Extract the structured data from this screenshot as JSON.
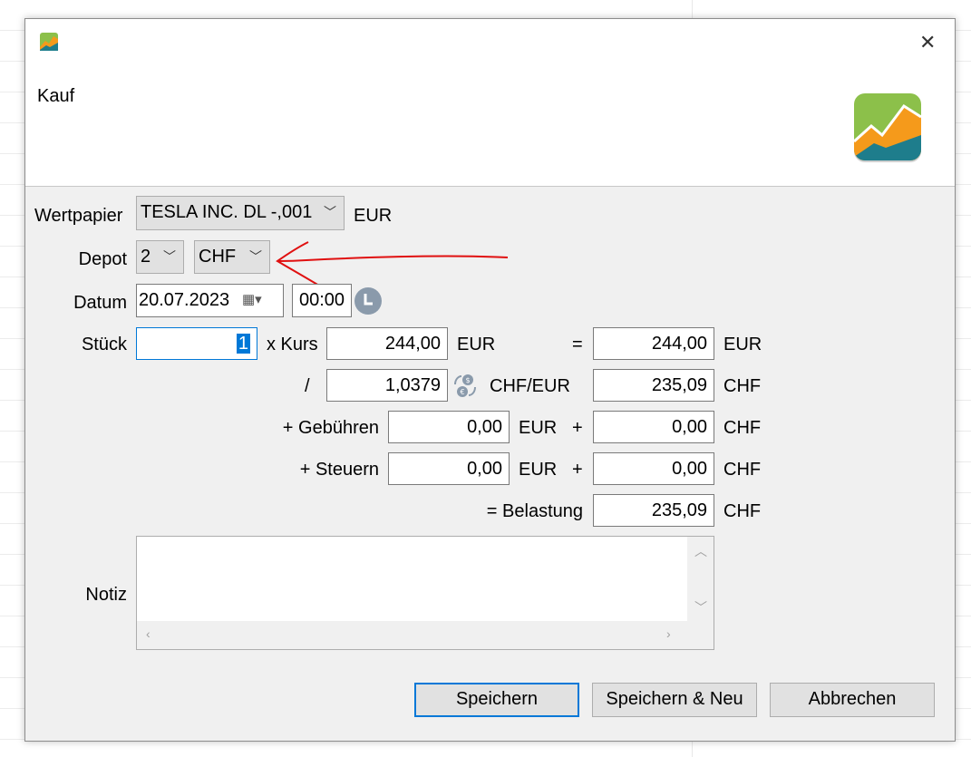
{
  "window": {
    "title": "Kauf",
    "close_glyph": "✕"
  },
  "form": {
    "wertpapier_label": "Wertpapier",
    "wertpapier_value": "TESLA INC. DL -,001",
    "wertpapier_currency": "EUR",
    "depot_label": "Depot",
    "depot_value": "2",
    "depot_currency": "CHF",
    "datum_label": "Datum",
    "date_value": "20.07.2023",
    "time_value": "00:00",
    "stueck_label": "Stück",
    "stueck_value": "1",
    "kurs_label": "x Kurs",
    "kurs_value": "244,00",
    "kurs_currency": "EUR",
    "equals_sign": "=",
    "converted_value": "244,00",
    "converted_currency": "EUR",
    "divide_sign": "/",
    "rate_value": "1,0379",
    "rate_unit": "CHF/EUR",
    "rate_result": "235,09",
    "rate_result_currency": "CHF",
    "fees_label": "+ Gebühren",
    "fees_value": "0,00",
    "fees_currency": "EUR",
    "plus_sign_1": "+",
    "fees_converted": "0,00",
    "fees_converted_currency": "CHF",
    "taxes_label": "+ Steuern",
    "taxes_value": "0,00",
    "taxes_currency": "EUR",
    "plus_sign_2": "+",
    "taxes_converted": "0,00",
    "taxes_converted_currency": "CHF",
    "total_label": "= Belastung",
    "total_value": "235,09",
    "total_currency": "CHF",
    "notiz_label": "Notiz",
    "notiz_value": ""
  },
  "buttons": {
    "save": "Speichern",
    "save_new": "Speichern & Neu",
    "cancel": "Abbrechen"
  },
  "colors": {
    "accent": "#0078d7",
    "annotation": "#e01010",
    "logo_green": "#8cc04a",
    "logo_orange": "#f59a1b",
    "logo_teal": "#1e7d8c"
  },
  "icons": {
    "app": "app-logo-icon",
    "calendar": "calendar-icon",
    "clock": "clock-icon",
    "convert": "currency-convert-icon"
  }
}
